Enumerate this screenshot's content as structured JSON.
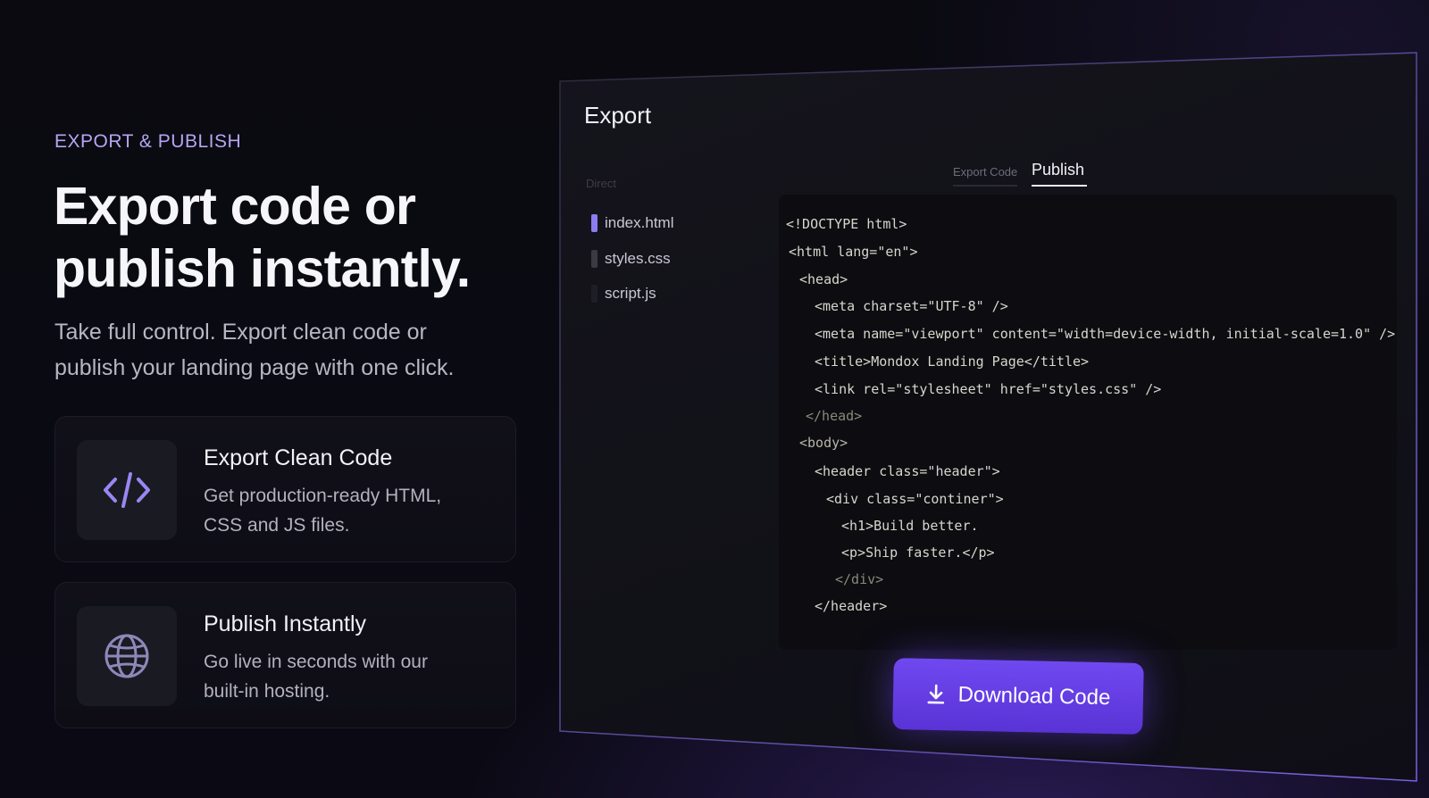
{
  "left": {
    "eyebrow": "EXPORT & PUBLISH",
    "headline_line1": "Export code or",
    "headline_line2": "publish instantly.",
    "subtext_line1": "Take full control. Export clean code or",
    "subtext_line2": "publish your landing page with one click."
  },
  "features": [
    {
      "icon": "code-icon",
      "title": "Export Clean Code",
      "desc_line1": "Get production-ready HTML,",
      "desc_line2": "CSS and JS files."
    },
    {
      "icon": "globe-icon",
      "title": "Publish Instantly",
      "desc_line1": "Go live in seconds with our",
      "desc_line2": "built-in hosting."
    }
  ],
  "panel": {
    "title": "Export",
    "files_label": "Direct",
    "files": [
      "index.html",
      "styles.css",
      "script.js"
    ],
    "tabs": [
      "Export Code",
      "Publish"
    ],
    "active_tab": "Publish",
    "code_lines": [
      "<!DOCTYPE html>",
      "<html lang=\"en\">",
      "<head>",
      "<meta charset=\"UTF-8\" />",
      "<meta name=\"viewport\" content=\"width=device-width, initial-scale=1.0\" />",
      "<title>Mondox Landing Page</title>",
      "<link rel=\"stylesheet\" href=\"styles.css\" />",
      "</head>",
      "<body>",
      "<header class=\"header\">",
      "<div class=\"continer\">",
      "<h1>Build better.",
      "<p>Ship faster.</p>",
      "</div>",
      "</header>"
    ],
    "download_label": "Download Code"
  },
  "colors": {
    "accent": "#6a42ee",
    "eyebrow": "#b7a5f2",
    "background": "#09090f"
  }
}
